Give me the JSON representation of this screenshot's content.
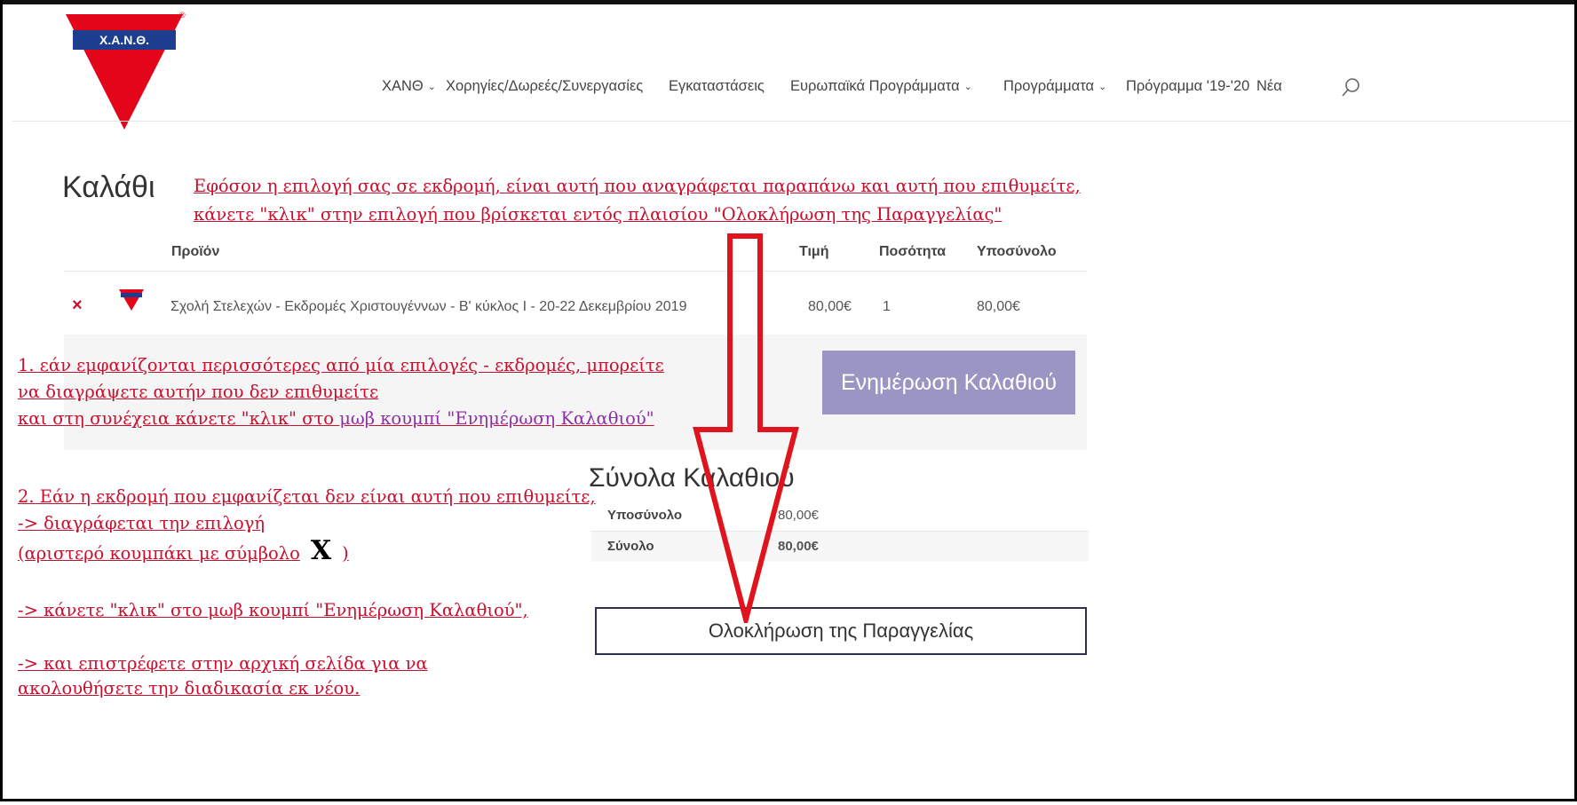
{
  "brand": {
    "logo_text": "Χ.Α.Ν.Θ.",
    "registered": "®"
  },
  "nav": {
    "items": [
      {
        "label": "ΧΑΝΘ",
        "dropdown": true
      },
      {
        "label": "Χορηγίες/Δωρεές/Συνεργασίες",
        "dropdown": false
      },
      {
        "label": "Εγκαταστάσεις",
        "dropdown": false
      },
      {
        "label": "Ευρωπαϊκά Προγράμματα",
        "dropdown": true
      },
      {
        "label": "Προγράμματα",
        "dropdown": true
      },
      {
        "label": "Πρόγραμμα '19-'20",
        "dropdown": false
      },
      {
        "label": "Νέα",
        "dropdown": false
      }
    ],
    "search_icon": "search-icon"
  },
  "page": {
    "title": "Καλάθι"
  },
  "annotations": {
    "top_line1": "Εφόσον η επιλογή σας σε εκδρομή, είναι αυτή που αναγράφεται παραπάνω και αυτή που επιθυμείτε,",
    "top_line2": "κάνετε \"κλικ\" στην επιλογή που βρίσκεται εντός πλαισίου \"Ολοκλήρωση της Παραγγελίας\"",
    "note1_line1": "1. εάν εμφανίζονται περισσότερες από μία επιλογές - εκδρομές, μπορείτε",
    "note1_line2": "να διαγράψετε αυτήν που δεν επιθυμείτε",
    "note1_line3_a": "και στη συνέχεια κάνετε \"κλικ\" στο ",
    "note1_line3_b": "μωβ κουμπί \"Ενημέρωση Καλαθιού\"",
    "note2_line1": "2. Εάν η εκδρομή που εμφανίζεται δεν είναι αυτή που επιθυμείτε,",
    "note2_line2": "-> διαγράφεται την επιλογή",
    "note2_line3_a": "(αριστερό κουμπάκι με σύμβολο",
    "note2_line3_x": "X",
    "note2_line3_b": ")",
    "note2_line4": "-> κάνετε \"κλικ\" στο μωβ κουμπί \"Ενημέρωση Καλαθιού\",",
    "note2_line5": "-> και επιστρέφετε στην αρχική σελίδα για να",
    "note2_line6": "ακολουθήσετε την διαδικασία εκ νέου."
  },
  "cart": {
    "headers": {
      "product": "Προϊόν",
      "price": "Τιμή",
      "qty": "Ποσότητα",
      "subtotal": "Υποσύνολο"
    },
    "items": [
      {
        "remove": "×",
        "name": "Σχολή Στελεχών - Εκδρομές Χριστουγέννων - Β' κύκλος Ι - 20-22 Δεκεμβρίου 2019",
        "price": "80,00€",
        "qty": "1",
        "subtotal": "80,00€"
      }
    ],
    "update_button": "Ενημέρωση Καλαθιού"
  },
  "totals": {
    "title": "Σύνολα Καλαθιού",
    "rows": [
      {
        "label": "Υποσύνολο",
        "value": "80,00€"
      },
      {
        "label": "Σύνολο",
        "value": "80,00€"
      }
    ],
    "checkout_button": "Ολοκλήρωση της Παραγγελίας"
  },
  "colors": {
    "accent_red": "#c8102e",
    "update_button": "#9a95c2",
    "annotation_purple": "#8e2fa8"
  }
}
